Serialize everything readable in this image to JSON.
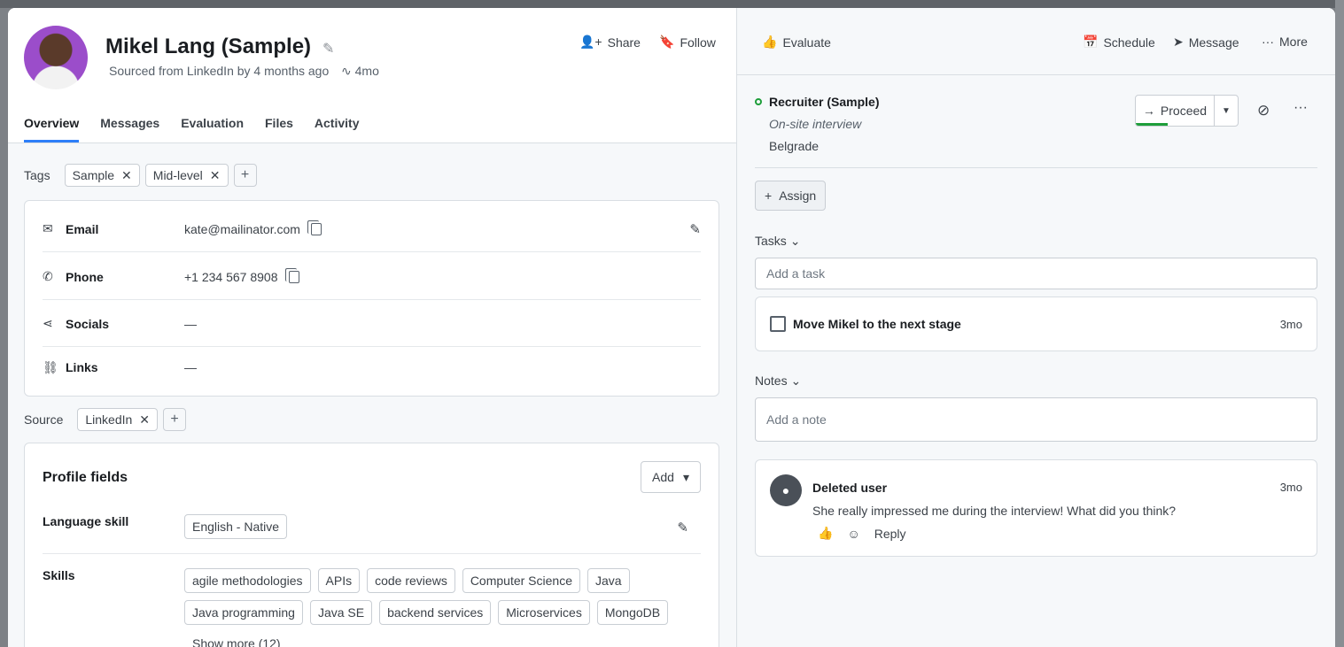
{
  "candidate": {
    "name": "Mikel Lang (Sample)",
    "sourced_text": "Sourced from LinkedIn by 4 months ago",
    "activity_age": "4mo"
  },
  "header_actions": {
    "share": "Share",
    "follow": "Follow"
  },
  "tabs": [
    "Overview",
    "Messages",
    "Evaluation",
    "Files",
    "Activity"
  ],
  "tags": {
    "label": "Tags",
    "items": [
      "Sample",
      "Mid-level"
    ]
  },
  "contact": {
    "email_label": "Email",
    "email": "kate@mailinator.com",
    "phone_label": "Phone",
    "phone": "+1 234 567 8908",
    "socials_label": "Socials",
    "socials": "—",
    "links_label": "Links",
    "links": "—"
  },
  "source": {
    "label": "Source",
    "items": [
      "LinkedIn"
    ]
  },
  "profile_fields": {
    "title": "Profile fields",
    "add_label": "Add",
    "language_label": "Language skill",
    "language_value": "English - Native",
    "skills_label": "Skills",
    "skills": [
      "agile methodologies",
      "APIs",
      "code reviews",
      "Computer Science",
      "Java",
      "Java programming",
      "Java SE",
      "backend services",
      "Microservices",
      "MongoDB"
    ],
    "show_more": "Show more (12)"
  },
  "right_actions": {
    "evaluate": "Evaluate",
    "schedule": "Schedule",
    "message": "Message",
    "more": "More"
  },
  "pipeline": {
    "job": "Recruiter (Sample)",
    "stage": "On-site interview",
    "location": "Belgrade",
    "proceed": "Proceed",
    "progress": 0.3
  },
  "assign_label": "Assign",
  "tasks": {
    "title": "Tasks",
    "placeholder": "Add a task",
    "items": [
      {
        "text": "Move Mikel to the next stage",
        "age": "3mo"
      }
    ]
  },
  "notes": {
    "title": "Notes",
    "placeholder": "Add a note",
    "items": [
      {
        "author": "Deleted user",
        "age": "3mo",
        "text": "She really impressed me during the interview! What did you think?",
        "reply": "Reply"
      }
    ]
  }
}
